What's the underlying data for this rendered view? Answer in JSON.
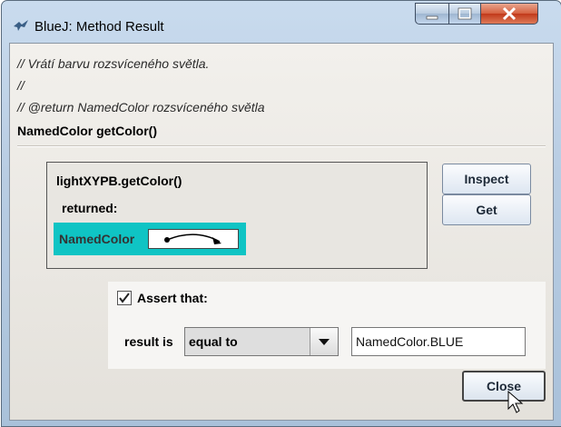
{
  "window": {
    "title": "BlueJ:  Method Result"
  },
  "method": {
    "comment_lines": [
      "// Vrátí barvu rozsvíceného světla.",
      "//",
      "// @return  NamedColor rozsvíceného světla"
    ],
    "signature": "NamedColor getColor()"
  },
  "result": {
    "call": "lightXYPB.getColor()",
    "returned_label": "returned:",
    "object_type": "NamedColor"
  },
  "buttons": {
    "inspect": "Inspect",
    "get": "Get",
    "close": "Close"
  },
  "assertion": {
    "checked": true,
    "label": "Assert that:",
    "result_is_label": "result is",
    "comparison": "equal to",
    "value": "NamedColor.BLUE"
  }
}
